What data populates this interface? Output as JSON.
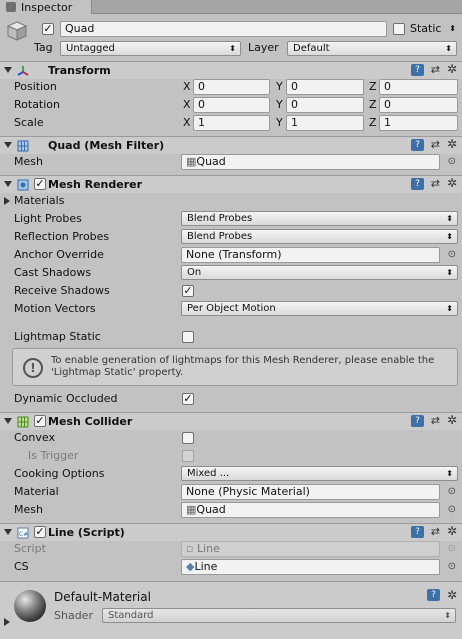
{
  "tab": {
    "label": "Inspector"
  },
  "object": {
    "active": true,
    "name": "Quad",
    "static_label": "Static",
    "static_checked": false,
    "tag_label": "Tag",
    "tag_value": "Untagged",
    "layer_label": "Layer",
    "layer_value": "Default"
  },
  "transform": {
    "title": "Transform",
    "position": {
      "label": "Position",
      "x": "0",
      "y": "0",
      "z": "0"
    },
    "rotation": {
      "label": "Rotation",
      "x": "0",
      "y": "0",
      "z": "0"
    },
    "scale": {
      "label": "Scale",
      "x": "1",
      "y": "1",
      "z": "1"
    },
    "axis_x": "X",
    "axis_y": "Y",
    "axis_z": "Z"
  },
  "mesh_filter": {
    "title": "Quad (Mesh Filter)",
    "mesh_label": "Mesh",
    "mesh_value": "Quad"
  },
  "mesh_renderer": {
    "title": "Mesh Renderer",
    "enabled": true,
    "materials_label": "Materials",
    "light_probes_label": "Light Probes",
    "light_probes_value": "Blend Probes",
    "reflection_probes_label": "Reflection Probes",
    "reflection_probes_value": "Blend Probes",
    "anchor_override_label": "Anchor Override",
    "anchor_override_value": "None (Transform)",
    "cast_shadows_label": "Cast Shadows",
    "cast_shadows_value": "On",
    "receive_shadows_label": "Receive Shadows",
    "receive_shadows_checked": true,
    "motion_vectors_label": "Motion Vectors",
    "motion_vectors_value": "Per Object Motion",
    "lightmap_static_label": "Lightmap Static",
    "lightmap_static_checked": false,
    "help_icon_text": "!",
    "help_text": "To enable generation of lightmaps for this Mesh Renderer, please enable the 'Lightmap Static' property.",
    "dynamic_occluded_label": "Dynamic Occluded",
    "dynamic_occluded_checked": true
  },
  "mesh_collider": {
    "title": "Mesh Collider",
    "enabled": true,
    "convex_label": "Convex",
    "convex_checked": false,
    "is_trigger_label": "Is Trigger",
    "is_trigger_checked": false,
    "cooking_options_label": "Cooking Options",
    "cooking_options_value": "Mixed ...",
    "material_label": "Material",
    "material_value": "None (Physic Material)",
    "mesh_label": "Mesh",
    "mesh_value": "Quad"
  },
  "line_script": {
    "title": "Line (Script)",
    "enabled": true,
    "script_label": "Script",
    "script_value": "Line",
    "cs_label": "CS",
    "cs_value": "Line"
  },
  "material": {
    "name": "Default-Material",
    "shader_label": "Shader",
    "shader_value": "Standard"
  },
  "glyphs": {
    "check": "✓",
    "dropdown": "⬍",
    "picker": "⊙",
    "gear": "✲",
    "preset": "⇄",
    "book": "?"
  },
  "colors": {
    "header_bg": "#cbcbcb",
    "panel_bg": "#c2c2c2",
    "help_book_blue": "#3d6fa8"
  }
}
